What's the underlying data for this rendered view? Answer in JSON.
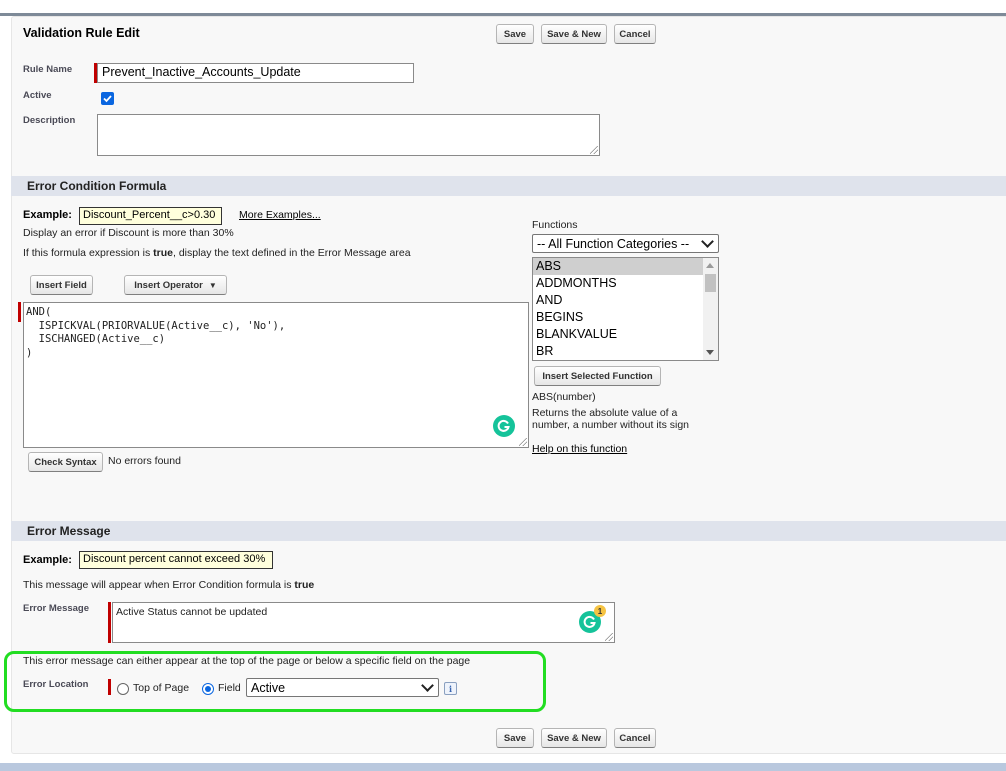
{
  "header": {
    "title": "Validation Rule Edit",
    "save_label": "Save",
    "save_new_label": "Save & New",
    "cancel_label": "Cancel"
  },
  "rule": {
    "name_label": "Rule Name",
    "name_value": "Prevent_Inactive_Accounts_Update",
    "active_label": "Active",
    "active_checked": true,
    "description_label": "Description",
    "description_value": ""
  },
  "formula_section": {
    "title": "Error Condition Formula",
    "example_label": "Example:",
    "example_value": "Discount_Percent__c>0.30",
    "more_examples": "More Examples...",
    "example_desc": "Display an error if Discount is more than 30%",
    "hint_prefix": "If this formula expression is ",
    "hint_bold": "true",
    "hint_suffix": ", display the text defined in the Error Message area",
    "insert_field": "Insert Field",
    "insert_operator": "Insert Operator",
    "formula": "AND(\n  ISPICKVAL(PRIORVALUE(Active__c), 'No'),\n  ISCHANGED(Active__c)\n)",
    "check_syntax": "Check Syntax",
    "syntax_status": "No errors found",
    "functions": {
      "label": "Functions",
      "category": "-- All Function Categories --",
      "items": [
        "ABS",
        "ADDMONTHS",
        "AND",
        "BEGINS",
        "BLANKVALUE",
        "BR"
      ],
      "selected": "ABS",
      "insert_selected": "Insert Selected Function",
      "signature": "ABS(number)",
      "description_line1": "Returns the absolute value of a",
      "description_line2": "number, a number without its sign",
      "help_link": "Help on this function"
    }
  },
  "message_section": {
    "title": "Error Message",
    "example_label": "Example:",
    "example_value": "Discount percent cannot exceed 30%",
    "hint_prefix": "This message will appear when Error Condition formula is ",
    "hint_bold": "true",
    "error_message_label": "Error Message",
    "error_message_value": "Active Status cannot be updated",
    "grammarly_count": "1",
    "location_hint": "This error message can either appear at the top of the page or below a specific field on the page",
    "location_label": "Error Location",
    "top_of_page": "Top of Page",
    "field_option": "Field",
    "field_value": "Active",
    "selected_location": "Field",
    "info": "i"
  },
  "colors": {
    "highlight": "#22dd22",
    "required": "#c00000",
    "grammarly": "#15c39a",
    "checkbox": "#0a66e0"
  }
}
